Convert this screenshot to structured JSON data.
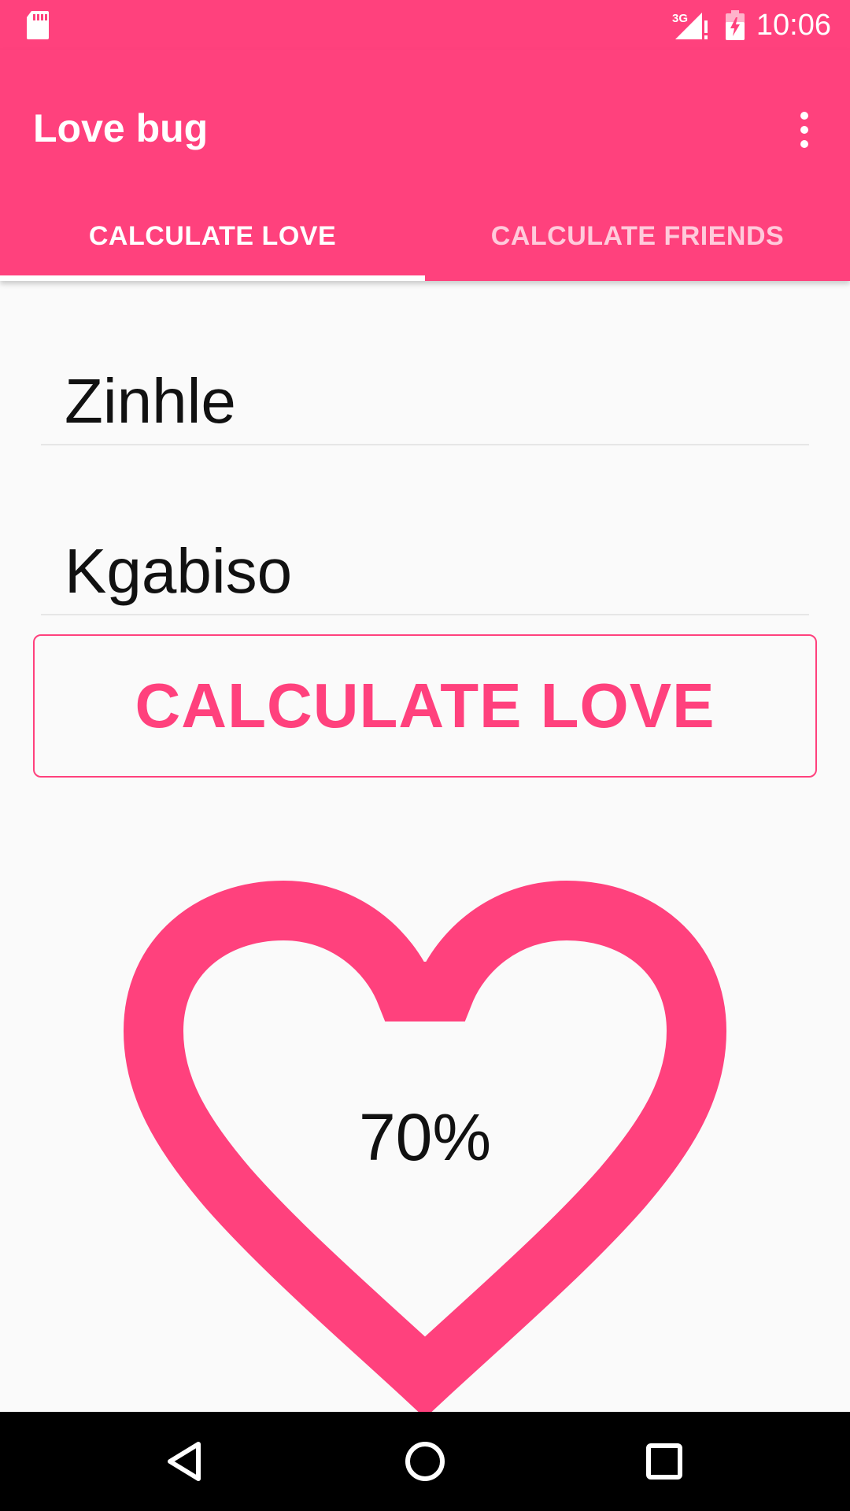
{
  "status_bar": {
    "time": "10:06",
    "network_label": "3G",
    "bg_color": "#ff417d",
    "icons": [
      "sd-card-icon",
      "signal-3g-icon",
      "battery-charging-icon"
    ]
  },
  "app_bar": {
    "title": "Love bug",
    "overflow_icon": "more-vert-icon"
  },
  "tabs": [
    {
      "label": "CALCULATE LOVE",
      "selected": true
    },
    {
      "label": "CALCULATE FRIENDS",
      "selected": false
    }
  ],
  "form": {
    "name1_value": "Zinhle",
    "name2_value": "Kgabiso",
    "button_label": "CALCULATE LOVE"
  },
  "result": {
    "percent_label": "70%"
  },
  "colors": {
    "accent": "#ff417d",
    "background": "#fafafa",
    "nav_bar": "#000000"
  },
  "nav_bar": {
    "icons": [
      "back-icon",
      "home-icon",
      "recents-icon"
    ]
  }
}
